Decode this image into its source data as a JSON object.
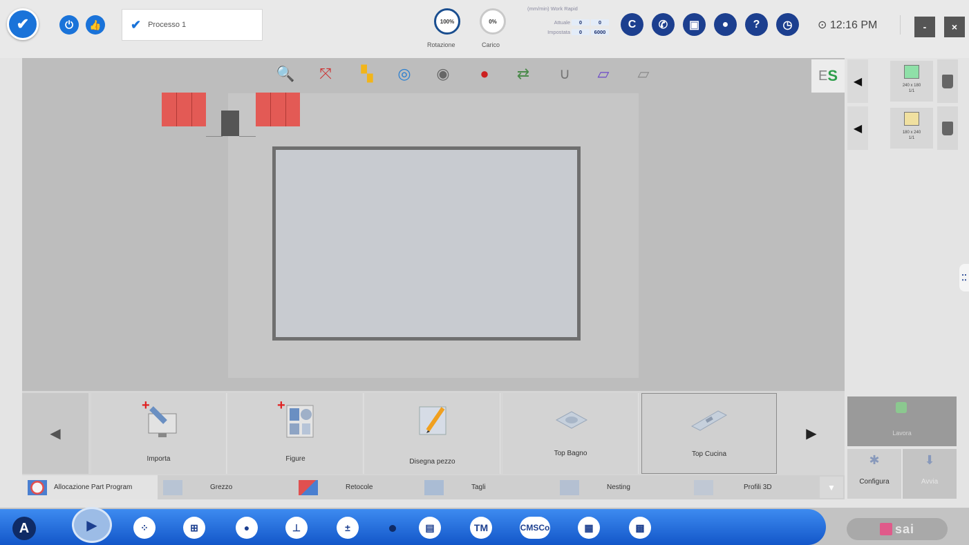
{
  "top_bar": {
    "process_name": "Processo 1",
    "gauge_rotation_value": "100%",
    "gauge_rotation_label": "Rotazione",
    "gauge_load_value": "0%",
    "gauge_load_label": "Carico",
    "speed_header": "(mm/min) Work Rapid",
    "speed_rows": [
      {
        "label": "Attuale",
        "work": "0",
        "rapid": "0"
      },
      {
        "label": "Impostata",
        "work": "0",
        "rapid": "6000"
      }
    ],
    "status_icons": [
      "c-icon",
      "phone-icon",
      "camera-icon",
      "user-icon",
      "help-icon",
      "timer-icon"
    ],
    "status_letter": "C",
    "clock": "12:16 PM",
    "minimize_label": "-",
    "close_label": "×"
  },
  "workspace": {
    "tool_icons": [
      "magnify-icon",
      "fit-icon",
      "layout-icon",
      "chat-icon",
      "camera-icon",
      "record-icon",
      "axes-icon",
      "magnet-icon",
      "slab-icon",
      "slab-edit-icon"
    ],
    "es_prefix": "E",
    "es_suffix": "S"
  },
  "right_panel": {
    "items": [
      {
        "caption_line1": "240 x 180",
        "caption_line2": "1/1",
        "color": "#8fe0a8"
      },
      {
        "caption_line1": "180 x 240",
        "caption_line2": "1/1",
        "color": "#f0e0a0"
      }
    ]
  },
  "actions": {
    "cards": [
      {
        "label": "Importa"
      },
      {
        "label": "Figure"
      },
      {
        "label": "Disegna pezzo"
      },
      {
        "label": "Top Bagno"
      },
      {
        "label": "Top Cucina"
      }
    ]
  },
  "tabs": [
    {
      "label": "Allocazione Part Program"
    },
    {
      "label": "Grezzo"
    },
    {
      "label": "Retocole"
    },
    {
      "label": "Tagli"
    },
    {
      "label": "Nesting"
    },
    {
      "label": "Profili 3D"
    }
  ],
  "config": {
    "top_label": "Lavora",
    "configure_label": "Configura",
    "start_label": "Avvia"
  },
  "taskbar": {
    "a_label": "A",
    "tm_label": "TM",
    "cms_label": "CMSCo",
    "brand": "sai"
  }
}
